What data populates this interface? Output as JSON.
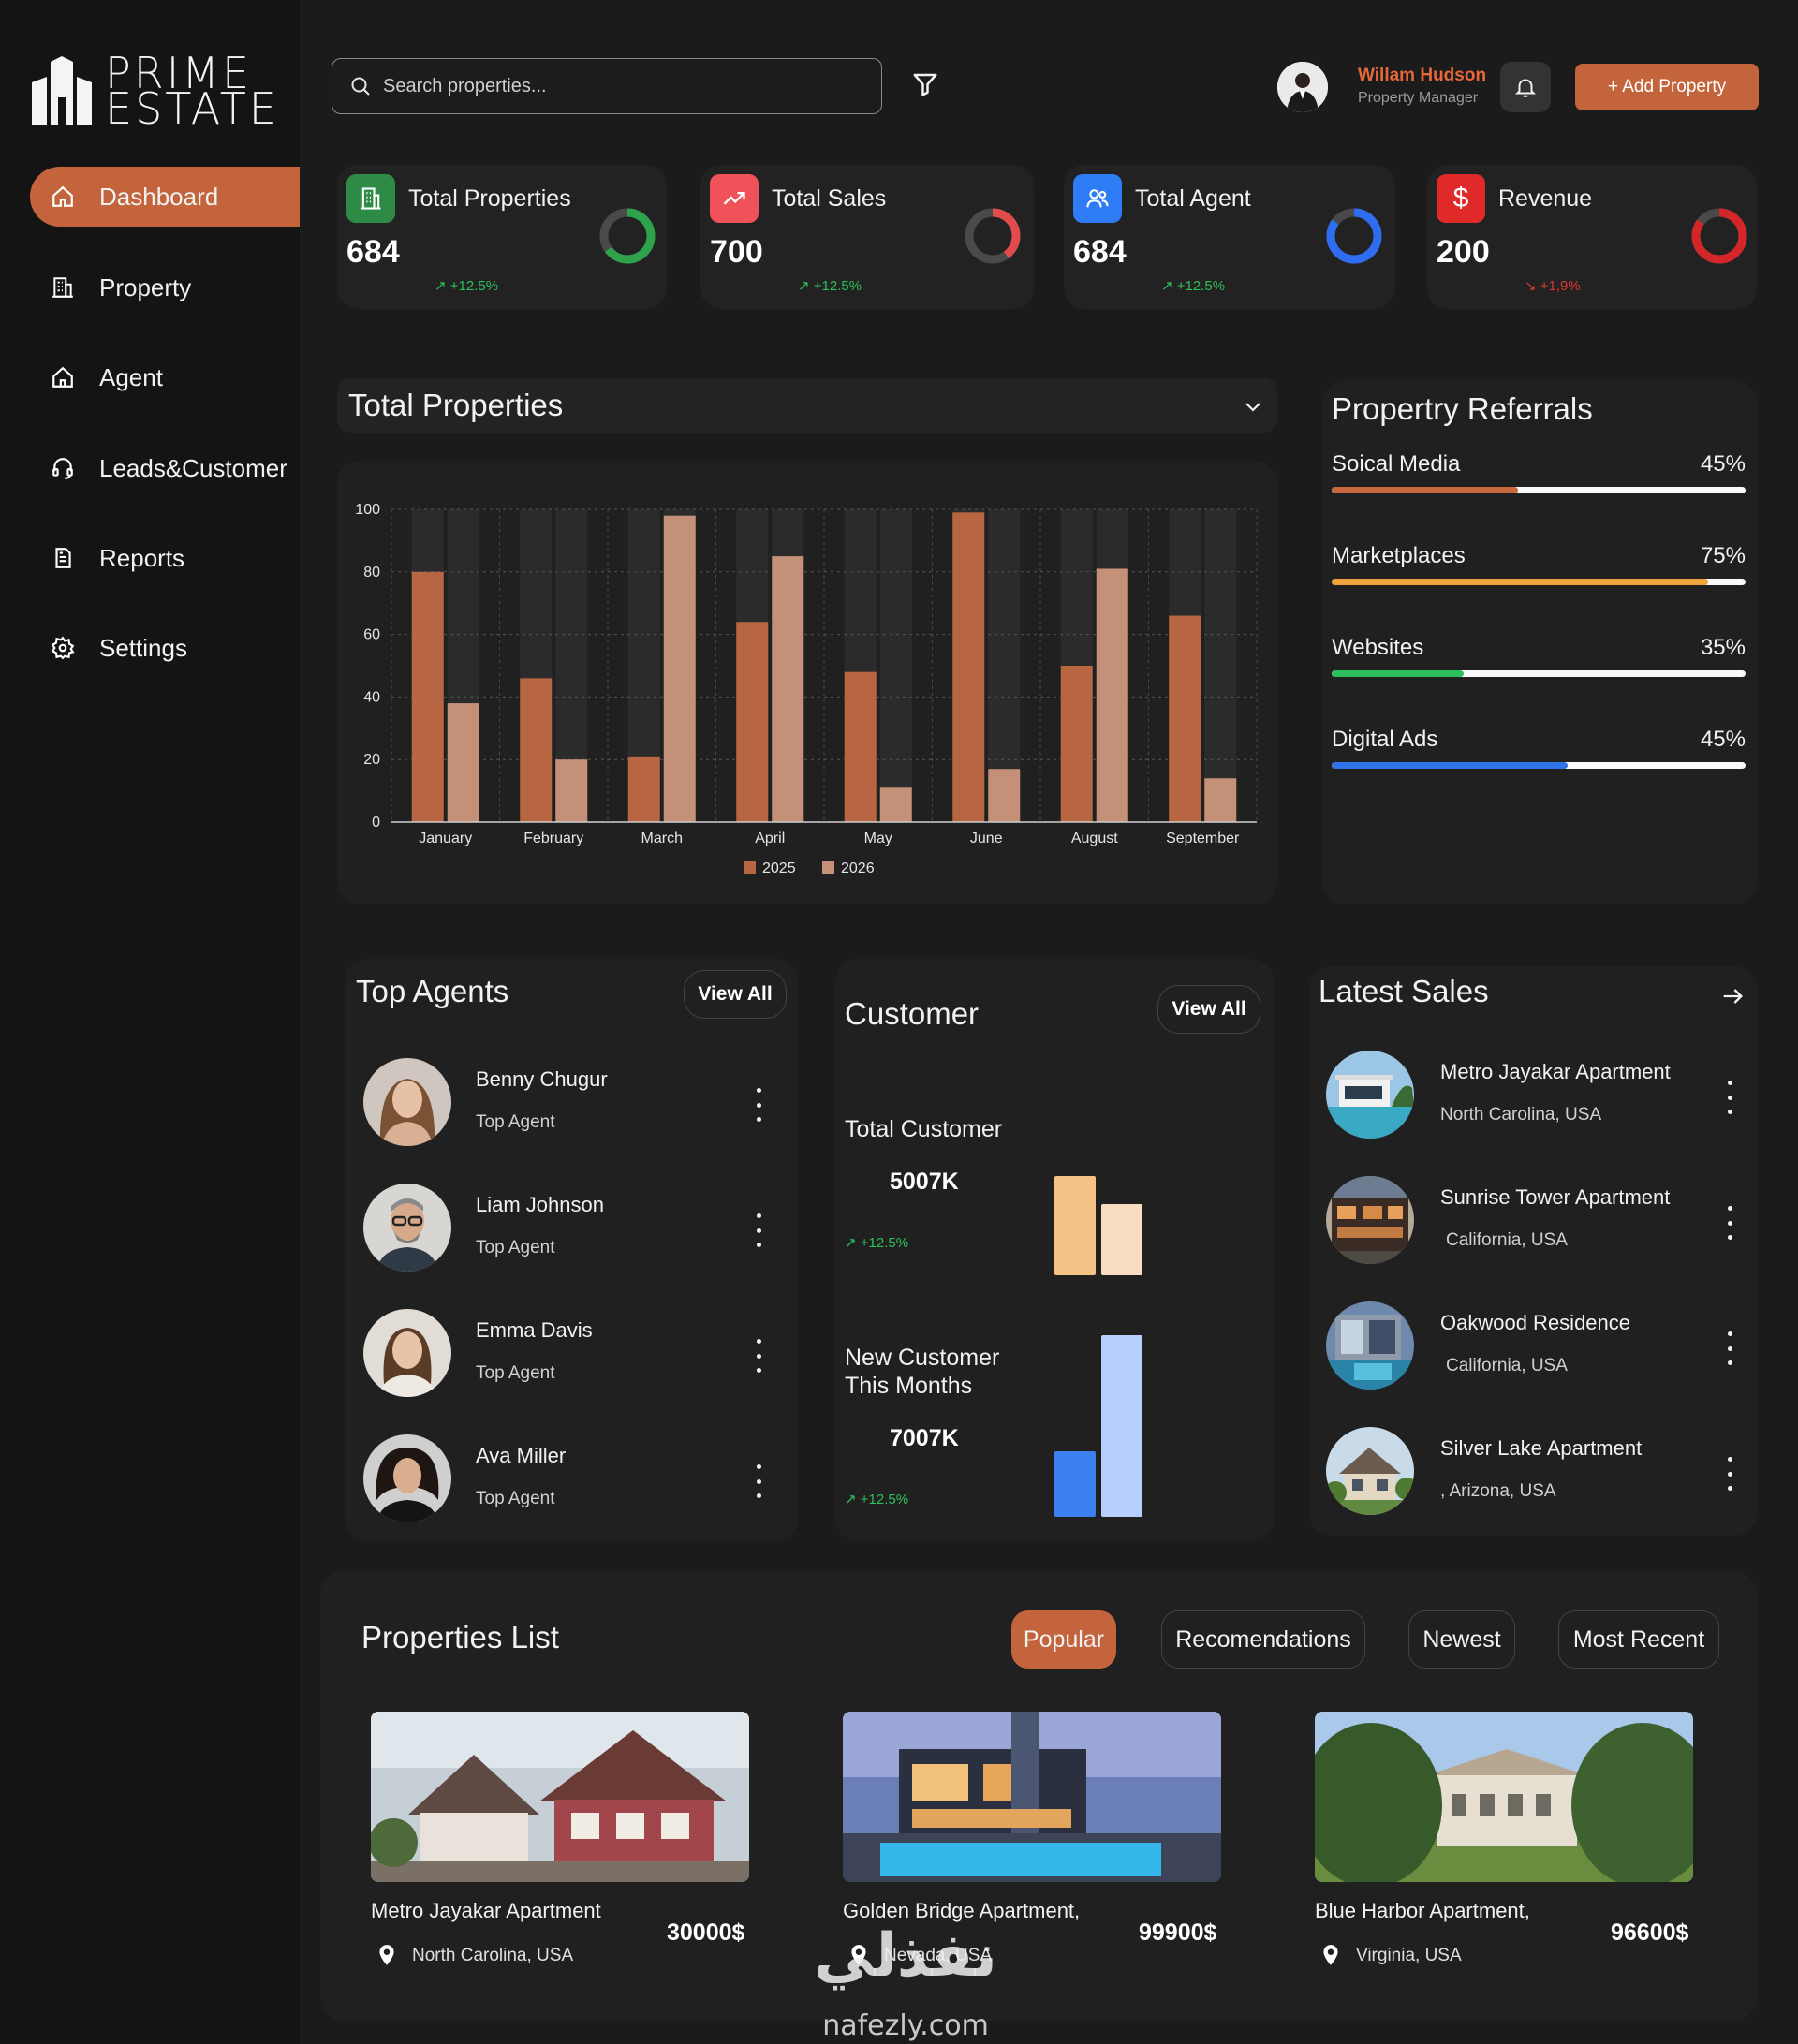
{
  "brand": {
    "line1": "PRIME",
    "line2": "ESTATE"
  },
  "sidebar": {
    "items": [
      {
        "label": "Dashboard",
        "icon": "home-icon",
        "active": true
      },
      {
        "label": "Property",
        "icon": "building-icon"
      },
      {
        "label": "Agent",
        "icon": "home-outline-icon"
      },
      {
        "label": "Leads&Customer",
        "icon": "headset-icon"
      },
      {
        "label": "Reports",
        "icon": "report-icon"
      },
      {
        "label": "Settings",
        "icon": "gear-icon"
      }
    ]
  },
  "header": {
    "search_placeholder": "Search properties...",
    "user_name": "Willam Hudson",
    "user_role": "Property Manager",
    "add_button": "+ Add Property"
  },
  "stats": [
    {
      "label": "Total Properties",
      "value": "684",
      "trend": "+12.5%",
      "trend_dir": "up",
      "icon": "building-icon",
      "icon_color": "#2e8b46",
      "ring_color": "#2fa34c",
      "ring_fraction": 0.65
    },
    {
      "label": "Total Sales",
      "value": "700",
      "trend": "+12.5%",
      "trend_dir": "up",
      "icon": "trend-up-icon",
      "icon_color": "#f0525a",
      "ring_color": "#e24b4b",
      "ring_fraction": 0.4
    },
    {
      "label": "Total Agent",
      "value": "684",
      "trend": "+12.5%",
      "trend_dir": "up",
      "icon": "users-icon",
      "icon_color": "#2e7cf6",
      "ring_color": "#2e6df0",
      "ring_fraction": 0.85
    },
    {
      "label": "Revenue",
      "value": "200",
      "trend": "+1,9%",
      "trend_dir": "down",
      "icon": "dollar-icon",
      "icon_color": "#e02a2a",
      "ring_color": "#d3262a",
      "ring_fraction": 0.85
    }
  ],
  "total_properties": {
    "title": "Total Properties"
  },
  "chart_data": {
    "type": "bar",
    "categories": [
      "January",
      "February",
      "March",
      "April",
      "May",
      "June",
      "August",
      "September"
    ],
    "series": [
      {
        "name": "2025",
        "values": [
          80,
          46,
          21,
          64,
          48,
          99,
          50,
          66
        ],
        "color": "#b86642"
      },
      {
        "name": "2026",
        "values": [
          38,
          20,
          98,
          85,
          11,
          17,
          81,
          14
        ],
        "color": "#c49078"
      }
    ],
    "yticks": [
      0,
      20,
      40,
      60,
      80,
      100
    ],
    "ylim": [
      0,
      100
    ],
    "grid": true,
    "legend": "bottom"
  },
  "referrals": {
    "title": "Propertry Referrals",
    "items": [
      {
        "label": "Soical Media",
        "percent_label": "45%",
        "value": 45,
        "color": "#c8683f"
      },
      {
        "label": "Marketplaces",
        "percent_label": "75%",
        "value": 91,
        "color": "#f2a23b"
      },
      {
        "label": "Websites",
        "percent_label": "35%",
        "value": 32,
        "color": "#2dbe5c"
      },
      {
        "label": "Digital Ads",
        "percent_label": "45%",
        "value": 57,
        "color": "#2f73e8"
      }
    ]
  },
  "top_agents": {
    "title": "Top Agents",
    "view_all": "View All",
    "agents": [
      {
        "name": "Benny Chugur",
        "role": "Top Agent"
      },
      {
        "name": "Liam Johnson",
        "role": "Top Agent"
      },
      {
        "name": "Emma Davis",
        "role": "Top Agent"
      },
      {
        "name": "Ava Miller",
        "role": "Top Agent"
      }
    ]
  },
  "customer": {
    "title": "Customer",
    "view_all": "View All",
    "total_label": "Total Customer",
    "total_value": "5007K",
    "total_trend": "+12.5%",
    "new_label_1": "New Customer",
    "new_label_2": "This Months",
    "new_value": "7007K",
    "new_trend": "+12.5%"
  },
  "latest_sales": {
    "title": "Latest Sales",
    "items": [
      {
        "name": "Metro Jayakar Apartment",
        "location": "North Carolina, USA"
      },
      {
        "name": "Sunrise Tower Apartment",
        "location": "California, USA"
      },
      {
        "name": "Oakwood Residence",
        "location": "California, USA"
      },
      {
        "name": "Silver Lake Apartment",
        "location": ", Arizona, USA"
      }
    ]
  },
  "properties_list": {
    "title": "Properties List",
    "tabs": [
      "Popular",
      "Recomendations",
      "Newest",
      "Most Recent"
    ],
    "active_tab": "Popular",
    "items": [
      {
        "name": "Metro Jayakar Apartment",
        "price": "30000$",
        "location": "North Carolina, USA"
      },
      {
        "name": "Golden Bridge Apartment,",
        "price": "99900$",
        "location": "Nevada, USA"
      },
      {
        "name": "Blue Harbor Apartment,",
        "price": "96600$",
        "location": "Virginia, USA"
      }
    ]
  },
  "watermark": {
    "arabic": "نفذلي",
    "latin": "nafezly.com"
  }
}
